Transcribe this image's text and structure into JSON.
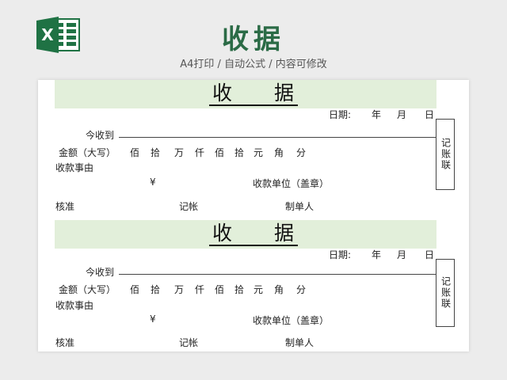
{
  "header": {
    "title": "收据",
    "subtitle": "A4打印 / 自动公式 / 内容可修改",
    "logo_icon": "excel-icon",
    "logo_letter": "X",
    "brand_color": "#2b6b46",
    "band_color": "#e2efda"
  },
  "receipts": [
    {
      "title": "收　　据",
      "date_label": "日期:",
      "year_label": "年",
      "month_label": "月",
      "day_label": "日",
      "payer_label": "今收到",
      "amount_label": "金额（大写）",
      "units": [
        "佰",
        "拾",
        "万",
        "仟",
        "佰",
        "拾",
        "元",
        "角",
        "分"
      ],
      "reason_label": "收款事由",
      "currency_symbol": "¥",
      "payee_label": "收款单位（盖章）",
      "approve_label": "核准",
      "bookkeep_label": "记帐",
      "maker_label": "制单人",
      "side_label": "记账联"
    },
    {
      "title": "收　　据",
      "date_label": "日期:",
      "year_label": "年",
      "month_label": "月",
      "day_label": "日",
      "payer_label": "今收到",
      "amount_label": "金额（大写）",
      "units": [
        "佰",
        "拾",
        "万",
        "仟",
        "佰",
        "拾",
        "元",
        "角",
        "分"
      ],
      "reason_label": "收款事由",
      "currency_symbol": "¥",
      "payee_label": "收款单位（盖章）",
      "approve_label": "核准",
      "bookkeep_label": "记帐",
      "maker_label": "制单人",
      "side_label": "记账联"
    }
  ]
}
